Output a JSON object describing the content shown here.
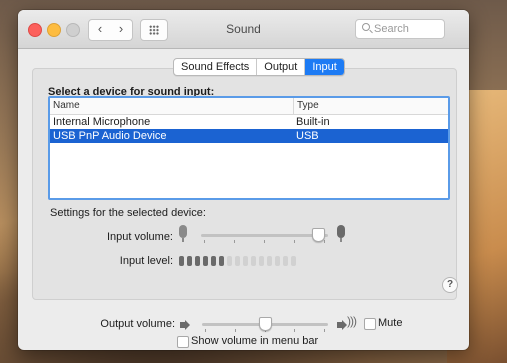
{
  "window": {
    "title": "Sound",
    "search_placeholder": "Search"
  },
  "tabs": [
    {
      "label": "Sound Effects",
      "active": false
    },
    {
      "label": "Output",
      "active": false
    },
    {
      "label": "Input",
      "active": true
    }
  ],
  "device_section": {
    "title": "Select a device for sound input:",
    "columns": [
      "Name",
      "Type"
    ],
    "rows": [
      {
        "name": "Internal Microphone",
        "type": "Built-in",
        "selected": false
      },
      {
        "name": "USB PnP Audio Device",
        "type": "USB",
        "selected": true
      }
    ]
  },
  "settings": {
    "title": "Settings for the selected device:",
    "input_volume_label": "Input volume:",
    "input_volume": 0.92,
    "input_level_label": "Input level:",
    "input_level_segments_total": 15,
    "input_level_segments_on": 6,
    "help_label": "?"
  },
  "output": {
    "volume_label": "Output volume:",
    "volume": 0.5,
    "mute_label": "Mute",
    "mute_checked": false,
    "menubar_label": "Show volume in menu bar",
    "menubar_checked": false
  },
  "colors": {
    "accent": "#1d7bf4",
    "selection": "#1b63d2"
  }
}
